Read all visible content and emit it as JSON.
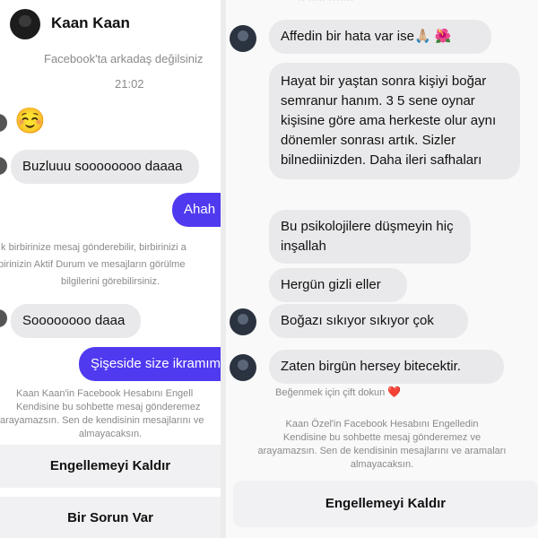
{
  "left": {
    "header": {
      "name": "Kaan Kaan",
      "subtitle": "Facebook'ta arkadaş değilsiniz"
    },
    "timestamp": "21:02",
    "emoji": "☺️",
    "messages": {
      "m1": "Buzluuu soooooooo daaaa",
      "m2": "Ahah",
      "m3": "Soooooooo daaa",
      "m4": "Şişeside size ikramım"
    },
    "notice_lines": [
      "ık birbirinize mesaj gönderebilir, birbirinizi a",
      "birinizin Aktif Durum ve mesajların görülme",
      "bilgilerini görebilirsiniz."
    ],
    "blocked_lines": [
      "Kaan Kaan'in Facebook Hesabını Engell",
      "Kendisine bu sohbette mesaj gönderemez",
      "arayamazsın. Sen de kendisinin mesajlarını ve",
      "almayacaksın."
    ],
    "buttons": {
      "unblock": "Engellemeyi Kaldır",
      "report": "Bir Sorun Var"
    }
  },
  "right": {
    "top_partial": "·· ·····  ·······",
    "messages": {
      "m1": "Affedin bir hata var ise🙏🏼 🌺",
      "m2": "Hayat bir yaştan sonra kişiyi boğar semranur hanım. 3 5 sene oynar kişisine göre ama herkeste olur aynı dönemler sonrası artık. Sizler bilnediinizden. Daha ileri safhaları",
      "m3": "Bu psikolojilere düşmeyin hiç inşallah",
      "m4": "Hergün gizli eller",
      "m5": "Boğazı sıkıyor sıkıyor çok",
      "m6": "Zaten birgün hersey bitecektir."
    },
    "like_hint": "Beğenmek için çift dokun",
    "like_icon": "❤️",
    "blocked_lines": [
      "Kaan Özel'in Facebook Hesabını Engelledin",
      "Kendisine bu sohbette mesaj gönderemez ve",
      "arayamazsın. Sen de kendisinin mesajlarını ve aramaları",
      "almayacaksın."
    ],
    "buttons": {
      "unblock": "Engellemeyi Kaldır"
    }
  }
}
